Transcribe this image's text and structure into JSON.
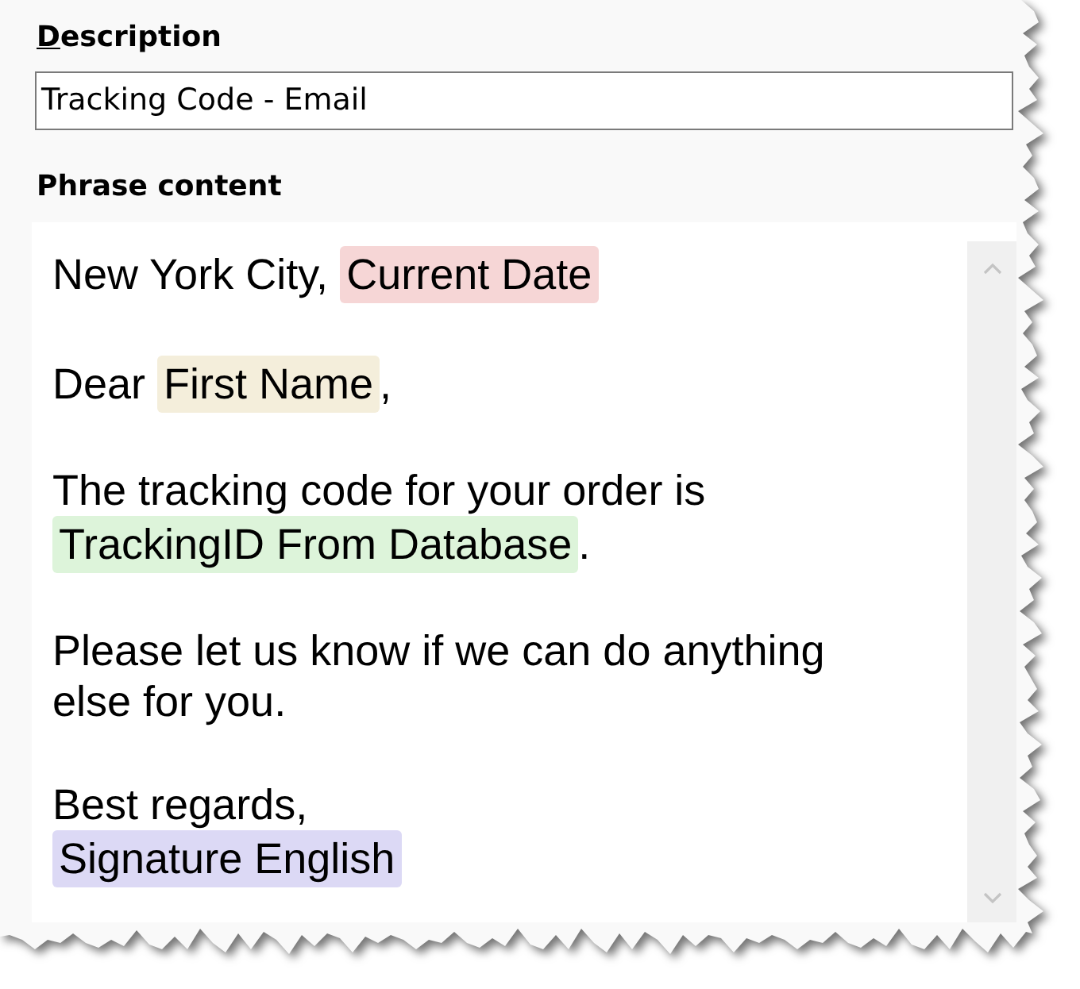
{
  "description": {
    "label": "Description",
    "mnemonic_underlined": true,
    "value": "Tracking Code - Email"
  },
  "phrase_content": {
    "label": "Phrase content",
    "paragraphs": [
      {
        "runs": [
          {
            "kind": "text",
            "text": "New York City, "
          },
          {
            "kind": "field",
            "text": "Current Date",
            "color": "#f6d6d6"
          }
        ]
      },
      {
        "runs": [
          {
            "kind": "text",
            "text": "Dear "
          },
          {
            "kind": "field",
            "text": "First Name",
            "color": "#f4eedb"
          },
          {
            "kind": "text",
            "text": ","
          }
        ]
      },
      {
        "runs": [
          {
            "kind": "text",
            "text": "The tracking code for your order is "
          },
          {
            "kind": "field",
            "text": "TrackingID From Database",
            "color": "#ddf4da"
          },
          {
            "kind": "text",
            "text": "."
          }
        ]
      },
      {
        "runs": [
          {
            "kind": "text",
            "text": "Please let us know if we can do anything else for you."
          }
        ]
      },
      {
        "runs": [
          {
            "kind": "text",
            "text": "Best regards,"
          },
          {
            "kind": "break"
          },
          {
            "kind": "field",
            "text": "Signature English",
            "color": "#dcd9f5"
          }
        ]
      }
    ]
  }
}
